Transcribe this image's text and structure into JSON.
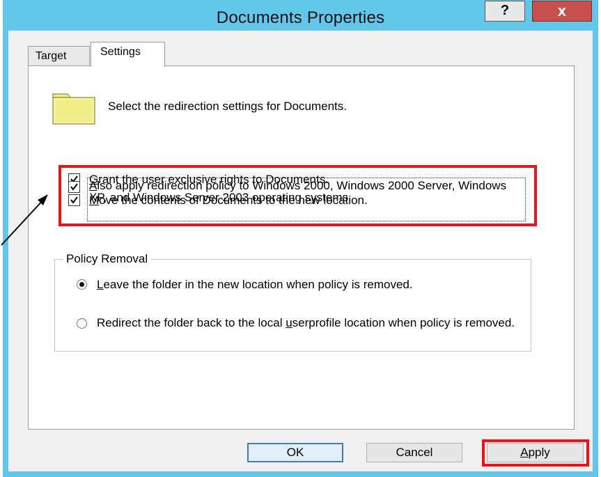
{
  "window": {
    "title": "Documents Properties",
    "help_label": "?",
    "close_label": "x"
  },
  "tabs": [
    {
      "label": "Target",
      "selected": false
    },
    {
      "label": "Settings",
      "selected": true
    }
  ],
  "settings": {
    "intro": "Select the redirection settings for Documents.",
    "checkboxes": [
      {
        "mnemonic": "G",
        "rest": "rant the user exclusive rights to Documents.",
        "checked": true
      },
      {
        "mnemonic": "M",
        "rest": "ove the contents of Documents to the new location.",
        "checked": true
      },
      {
        "mnemonic": "A",
        "rest": "lso apply redirection policy to Windows 2000, Windows 2000 Server, Windows XP, and Windows Server 2003 operating systems.",
        "checked": true
      }
    ],
    "policy_removal": {
      "legend": "Policy Removal",
      "options": [
        {
          "pre": "",
          "mnemonic": "L",
          "post": "eave the folder in the new location when policy is removed.",
          "selected": true
        },
        {
          "pre": "Redirect the folder back to the local ",
          "mnemonic": "u",
          "post": "serprofile location when policy is removed.",
          "selected": false
        }
      ]
    }
  },
  "buttons": {
    "ok": "OK",
    "cancel": "Cancel",
    "apply_mnemonic": "A",
    "apply_rest": "pply"
  },
  "colors": {
    "titlebar": "#63c7ea",
    "close_button": "#c7504b",
    "annotation_red": "#e2161b",
    "folder_yellow": "#f2ef8a"
  },
  "icons": {
    "folder": "folder-icon",
    "annotation_arrow": "arrow-icon"
  }
}
